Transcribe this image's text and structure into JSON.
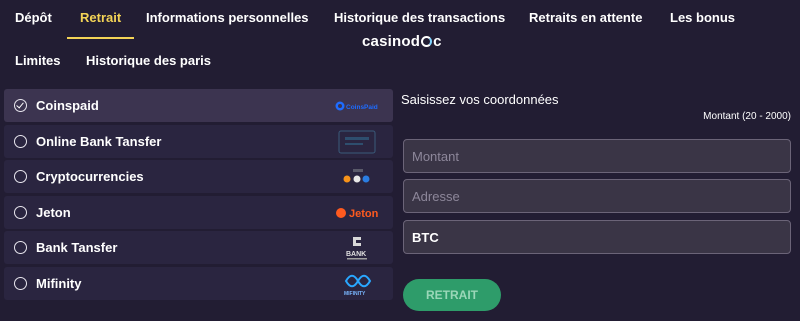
{
  "tabs": [
    {
      "label": "Dépôt"
    },
    {
      "label": "Retrait"
    },
    {
      "label": "Informations personnelles"
    },
    {
      "label": "Historique des transactions"
    },
    {
      "label": "Retraits en attente"
    },
    {
      "label": "Les bonus"
    },
    {
      "label": "Limites"
    },
    {
      "label": "Historique des paris"
    }
  ],
  "active_tab": "Retrait",
  "watermark": {
    "pre": "casinod",
    "post": "c"
  },
  "methods": [
    {
      "label": "Coinspaid",
      "logo_text": "CoinsPaid",
      "selected": true
    },
    {
      "label": "Online Bank Tansfer",
      "logo_text": "",
      "selected": false
    },
    {
      "label": "Cryptocurrencies",
      "logo_text": "",
      "selected": false
    },
    {
      "label": "Jeton",
      "logo_text": "Jeton",
      "selected": false
    },
    {
      "label": "Bank Tansfer",
      "logo_text": "BANK",
      "selected": false
    },
    {
      "label": "Mifinity",
      "logo_text": "MIFINITY",
      "selected": false
    }
  ],
  "form": {
    "title": "Saisissez vos coordonnées",
    "amount_range": "Montant (20 - 2000)",
    "amount_placeholder": "Montant",
    "address_placeholder": "Adresse",
    "currency_value": "BTC",
    "submit_label": "RETRAIT"
  },
  "colors": {
    "background": "#221d33",
    "accent": "#f3d356",
    "submit": "#2e9c6a"
  }
}
